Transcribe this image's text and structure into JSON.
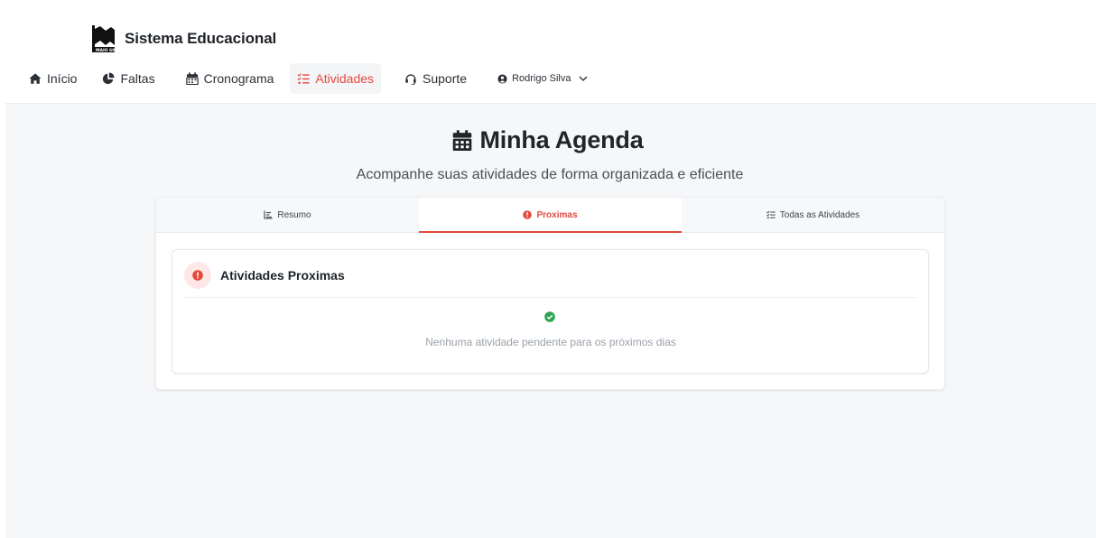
{
  "brand": {
    "name": "Sistema Educacional",
    "logo_icon": "school-logo-icon"
  },
  "nav": {
    "items": [
      {
        "label": "Início",
        "icon": "home-icon"
      },
      {
        "label": "Faltas",
        "icon": "pie-chart-icon"
      },
      {
        "label": "Cronograma",
        "icon": "calendar-icon"
      },
      {
        "label": "Atividades",
        "icon": "list-check-icon",
        "active": true
      },
      {
        "label": "Suporte",
        "icon": "headset-icon"
      }
    ],
    "user": {
      "name": "Rodrigo Silva",
      "icon": "user-circle-icon"
    }
  },
  "page": {
    "title": "Minha Agenda",
    "title_icon": "calendar-icon",
    "subtitle": "Acompanhe suas atividades de forma organizada e eficiente"
  },
  "tabs": [
    {
      "label": "Resumo",
      "icon": "chart-line-icon"
    },
    {
      "label": "Proximas",
      "icon": "alert-circle-icon",
      "active": true
    },
    {
      "label": "Todas as Atividades",
      "icon": "list-check-icon"
    }
  ],
  "upcoming": {
    "title": "Atividades Proximas",
    "empty_message": "Nenhuma atividade pendente para os próximos dias"
  },
  "colors": {
    "accent": "#e5483d",
    "success": "#2da44e",
    "background": "#f6f7f9"
  }
}
